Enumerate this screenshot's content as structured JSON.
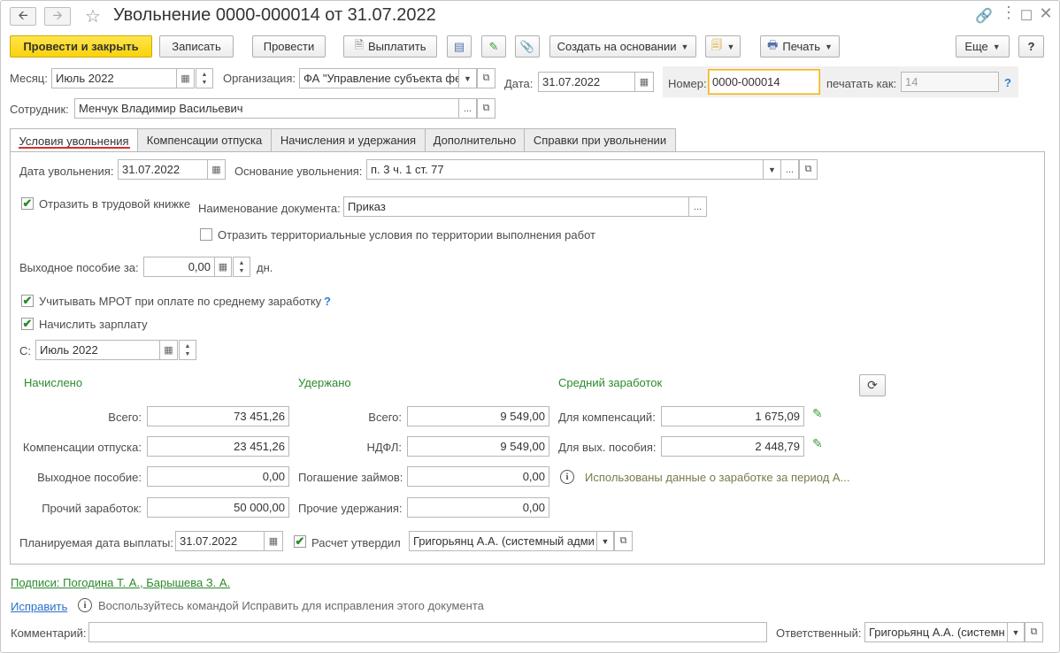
{
  "window": {
    "title": "Увольнение 0000-000014 от 31.07.2022"
  },
  "icons": {
    "back": "arrow-left-icon",
    "forward": "arrow-right-icon",
    "favorite": "star-icon",
    "link": "link-icon",
    "more": "more-icon",
    "maximize": "maximize-icon",
    "close": "close-icon"
  },
  "toolbar": {
    "post_close": "Провести и закрыть",
    "save": "Записать",
    "post": "Провести",
    "pay": "Выплатить",
    "create_based": "Создать на основании",
    "print": "Печать",
    "more": "Еще",
    "help": "?"
  },
  "header": {
    "month_label": "Месяц:",
    "month_value": "Июль 2022",
    "org_label": "Организация:",
    "org_value": "ФА \"Управление субъекта фе",
    "date_label": "Дата:",
    "date_value": "31.07.2022",
    "number_label": "Номер:",
    "number_value": "0000-000014",
    "print_as_label": "печатать как:",
    "print_as_value": "14",
    "employee_label": "Сотрудник:",
    "employee_value": "Менчук Владимир Васильевич"
  },
  "tabs": [
    {
      "label": "Условия увольнения"
    },
    {
      "label": "Компенсации отпуска"
    },
    {
      "label": "Начисления и удержания"
    },
    {
      "label": "Дополнительно"
    },
    {
      "label": "Справки при увольнении"
    }
  ],
  "conditions": {
    "dismissal_date_label": "Дата увольнения:",
    "dismissal_date_value": "31.07.2022",
    "reason_label": "Основание увольнения:",
    "reason_value": "п. 3 ч. 1 ст. 77",
    "reflect_workbook_label": "Отразить в трудовой книжке",
    "doc_name_label": "Наименование документа:",
    "doc_name_value": "Приказ",
    "territorial_label": "Отразить территориальные условия по территории выполнения работ",
    "severance_label": "Выходное пособие за:",
    "severance_value": "0,00",
    "severance_unit": "дн.",
    "mrot_label": "Учитывать МРОТ при оплате по среднему заработку",
    "accrue_salary_label": "Начислить зарплату",
    "from_label": "С:",
    "from_value": "Июль 2022"
  },
  "accrued": {
    "heading": "Начислено",
    "total_label": "Всего:",
    "total": "73 451,26",
    "vacation_label": "Компенсации отпуска:",
    "vacation": "23 451,26",
    "severance_label": "Выходное пособие:",
    "severance": "0,00",
    "other_label": "Прочий заработок:",
    "other": "50 000,00"
  },
  "withheld": {
    "heading": "Удержано",
    "total_label": "Всего:",
    "total": "9 549,00",
    "ndfl_label": "НДФЛ:",
    "ndfl": "9 549,00",
    "loans_label": "Погашение займов:",
    "loans": "0,00",
    "other_label": "Прочие удержания:",
    "other": "0,00"
  },
  "average": {
    "heading": "Средний заработок",
    "comp_label": "Для компенсаций:",
    "comp": "1 675,09",
    "sev_label": "Для вых. пособия:",
    "sev": "2 448,79",
    "info": "Использованы данные о заработке за период А..."
  },
  "payment": {
    "planned_label": "Планируемая дата выплаты:",
    "planned_value": "31.07.2022",
    "approved_label": "Расчет утвердил",
    "approved_value": "Григорьянц А.А. (системный адми"
  },
  "footer": {
    "signatures": "Подписи: Погодина Т. А., Барышева З. А.",
    "fix_link": "Исправить",
    "fix_hint": "Воспользуйтесь командой Исправить для исправления этого документа",
    "comment_label": "Комментарий:",
    "comment_value": "",
    "responsible_label": "Ответственный:",
    "responsible_value": "Григорьянц А.А. (системн"
  },
  "colors": {
    "accent_yellow": "#f8d30b",
    "green_text": "#2c8a2c",
    "link_blue": "#2a7fd4",
    "active_tab_underline": "#d62f2f"
  }
}
